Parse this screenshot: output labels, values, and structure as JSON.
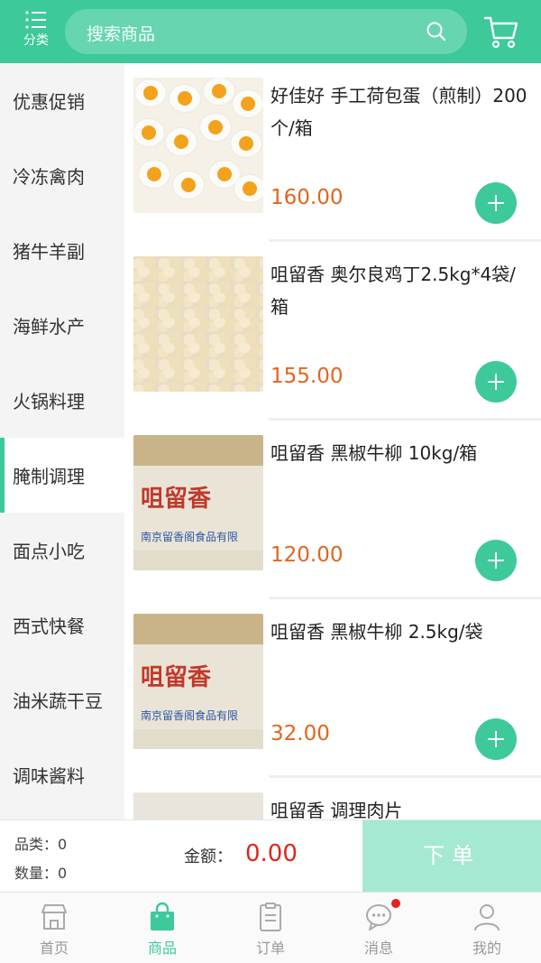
{
  "header": {
    "menu_label": "分类",
    "search_placeholder": "搜索商品",
    "accent_color": "#3dc99a"
  },
  "sidebar": {
    "active_index": 5,
    "items": [
      "优惠促销",
      "冷冻禽肉",
      "猪牛羊副",
      "海鲜水产",
      "火锅料理",
      "腌制调理",
      "面点小吃",
      "西式快餐",
      "油米蔬干豆",
      "调味酱料"
    ]
  },
  "products": [
    {
      "name": "好佳好 手工荷包蛋（煎制）200个/箱",
      "price": "160.00",
      "image": "fried-eggs"
    },
    {
      "name": "咀留香 奥尔良鸡丁2.5kg*4袋/箱",
      "price": "155.00",
      "image": "chicken-cubes"
    },
    {
      "name": "咀留香 黑椒牛柳 10kg/箱",
      "price": "120.00",
      "image": "carton-box",
      "box_brand": "咀留香",
      "box_text": "南京留香阁食品有限"
    },
    {
      "name": "咀留香 黑椒牛柳 2.5kg/袋",
      "price": "32.00",
      "image": "carton-box",
      "box_brand": "咀留香",
      "box_text": "南京留香阁食品有限"
    },
    {
      "name": "咀留香 调理肉片",
      "price": "",
      "image": "package"
    }
  ],
  "cart": {
    "category_label": "品类：",
    "category_count": "0",
    "quantity_label": "数量：",
    "quantity_count": "0",
    "amount_label": "金额：",
    "amount": "0.00",
    "order_button": "下单"
  },
  "tabbar": {
    "active_index": 1,
    "items": [
      {
        "label": "首页",
        "icon": "store-icon"
      },
      {
        "label": "商品",
        "icon": "shopping-bag-icon"
      },
      {
        "label": "订单",
        "icon": "clipboard-icon"
      },
      {
        "label": "消息",
        "icon": "chat-bubble-icon",
        "badge": true
      },
      {
        "label": "我的",
        "icon": "user-icon"
      }
    ]
  }
}
